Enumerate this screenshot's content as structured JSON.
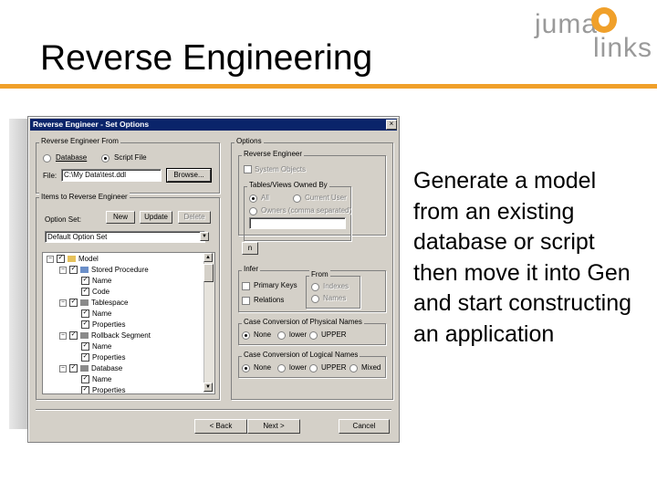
{
  "slide": {
    "title": "Reverse Engineering",
    "logo": {
      "line1": "juma",
      "line2": "links"
    },
    "body": "Generate a model from an existing database or script then move it into Gen and start constructing an application"
  },
  "dialog": {
    "title": "Reverse Engineer - Set Options",
    "close": "×",
    "reverse_from": {
      "label": "Reverse Engineer From",
      "database": "Database",
      "script_file": "Script File",
      "file_label": "File:",
      "file_value": "C:\\My Data\\test.ddl",
      "browse": "Browse..."
    },
    "items": {
      "label": "Items to Reverse Engineer",
      "option_set_label": "Option Set:",
      "new": "New",
      "update": "Update",
      "delete": "Delete",
      "option_set_value": "Default Option Set"
    },
    "tree": [
      {
        "indent": 0,
        "label": "Model",
        "plus": true,
        "icon": "folder"
      },
      {
        "indent": 1,
        "label": "Stored Procedure",
        "plus": true,
        "icon": "proc"
      },
      {
        "indent": 2,
        "label": "Name"
      },
      {
        "indent": 2,
        "label": "Code"
      },
      {
        "indent": 1,
        "label": "Tablespace",
        "plus": true,
        "icon": "db"
      },
      {
        "indent": 2,
        "label": "Name"
      },
      {
        "indent": 2,
        "label": "Properties"
      },
      {
        "indent": 1,
        "label": "Rollback Segment",
        "plus": true,
        "icon": "db"
      },
      {
        "indent": 2,
        "label": "Name"
      },
      {
        "indent": 2,
        "label": "Properties"
      },
      {
        "indent": 1,
        "label": "Database",
        "plus": true,
        "icon": "db"
      },
      {
        "indent": 2,
        "label": "Name"
      },
      {
        "indent": 2,
        "label": "Properties"
      }
    ],
    "options": {
      "label": "Options",
      "reverse_engineer_label": "Reverse Engineer",
      "system_objects": "System Objects",
      "owned_by_label": "Tables/Views Owned By",
      "all": "All",
      "current_user": "Current User",
      "owners": "Owners (comma separated)",
      "n_button": "n",
      "infer_label": "Infer",
      "primary_keys": "Primary Keys",
      "relations": "Relations",
      "from_label": "From",
      "indexes": "Indexes",
      "names": "Names",
      "physical_label": "Case Conversion of Physical Names",
      "logical_label": "Case Conversion of Logical Names",
      "none": "None",
      "lower": "lower",
      "upper": "UPPER",
      "mixed": "Mixed"
    },
    "footer": {
      "back": "< Back",
      "next": "Next >",
      "cancel": "Cancel"
    }
  }
}
